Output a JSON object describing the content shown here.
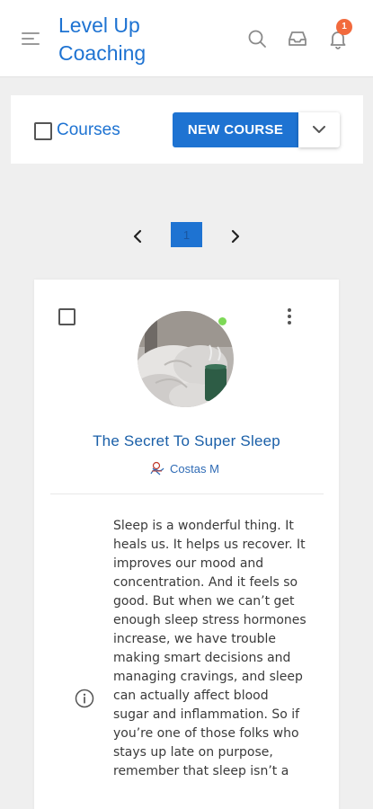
{
  "header": {
    "title": "Level Up Coaching",
    "notification_count": "1",
    "icons": [
      "menu-icon",
      "search-icon",
      "inbox-icon",
      "bell-icon"
    ],
    "accent_color": "#1e73d2",
    "badge_color": "#f26a3d"
  },
  "toolbar": {
    "label": "Courses",
    "new_course_label": "NEW COURSE",
    "dropdown_icon": "chevron-down-icon"
  },
  "pagination": {
    "current_page": "1",
    "prev_icon": "chevron-left-icon",
    "next_icon": "chevron-right-icon"
  },
  "course": {
    "title": "The Secret To Super Sleep",
    "author": "Costas M",
    "status_color": "#7ed957",
    "description": "Sleep is a wonderful thing. It heals us. It helps us recover. It improves our mood and concentration. And it feels so good. But when we can’t get enough sleep stress hormones increase, we have trouble making smart decisions and managing cravings, and sleep can actually affect blood sugar and inflammation. So if you’re one of those folks who stays up late on purpose, remember that sleep isn’t a"
  }
}
